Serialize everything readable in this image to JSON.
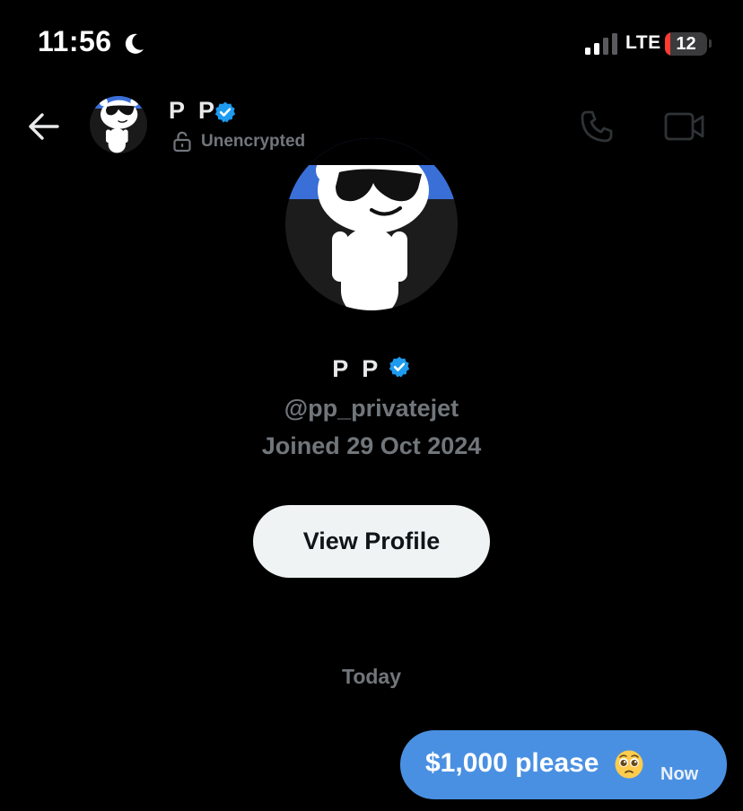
{
  "status_bar": {
    "time": "11:56",
    "network": "LTE",
    "battery": "12",
    "battery_level": 0.12,
    "icons": [
      "moon-icon",
      "signal-icon",
      "battery-icon"
    ]
  },
  "header": {
    "name": "P P",
    "encryption_status": "Unencrypted",
    "icons": [
      "back-arrow-icon",
      "verified-icon",
      "lock-open-icon",
      "phone-icon",
      "video-camera-icon"
    ]
  },
  "profile": {
    "name": "P P",
    "handle": "@pp_privatejet",
    "joined": "Joined 29 Oct 2024",
    "view_profile_label": "View Profile"
  },
  "conversation": {
    "date_separator": "Today",
    "messages": [
      {
        "text": "$1,000 please",
        "emoji": "pleading-face-emoji",
        "time": "Now",
        "direction": "outgoing"
      }
    ]
  },
  "colors": {
    "background": "#000000",
    "verified": "#1d9bf0",
    "bubble": "#4a90e2",
    "muted_text": "#71767b",
    "button_bg": "#eff3f4",
    "battery_low": "#ff3b30"
  }
}
